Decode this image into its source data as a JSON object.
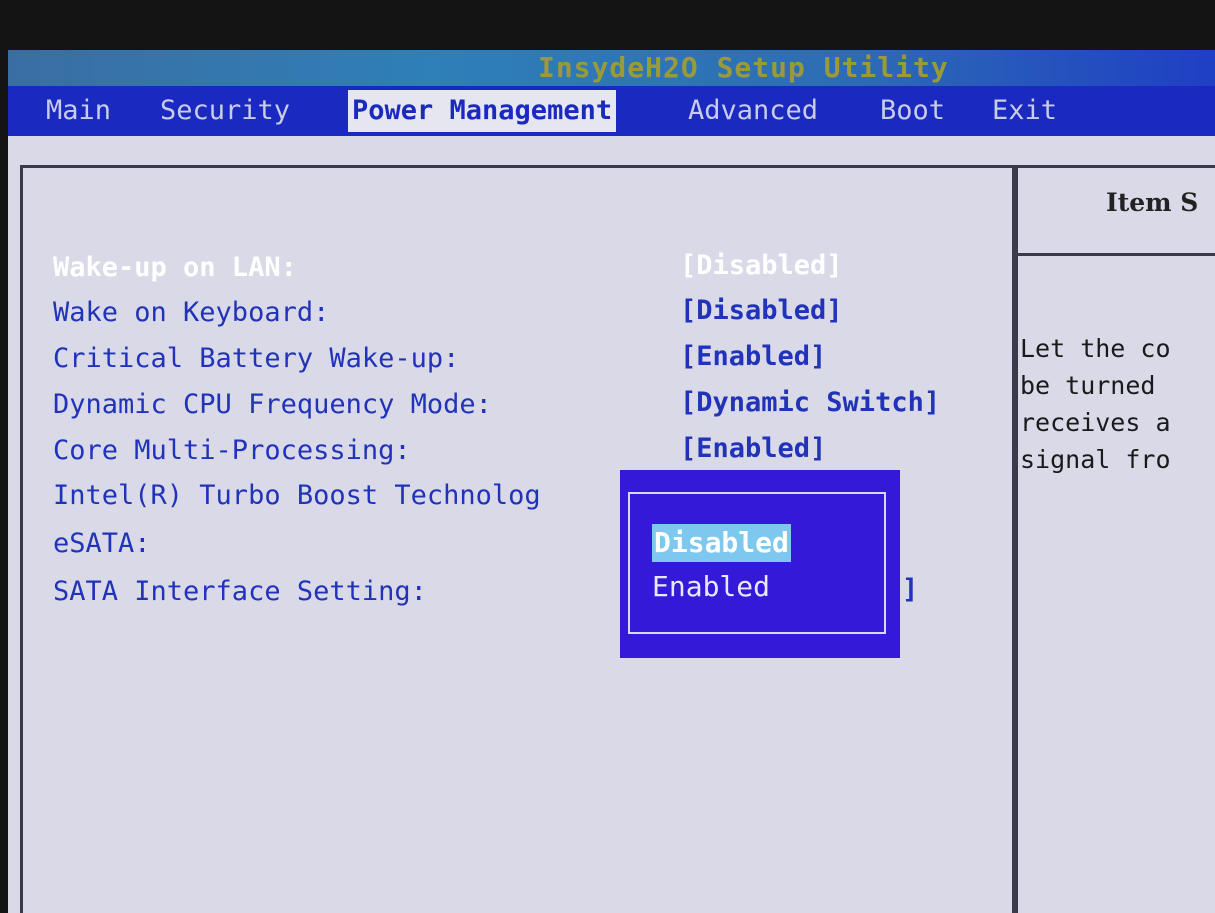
{
  "title": "InsydeH2O Setup Utility",
  "menu": {
    "items": [
      {
        "label": "Main"
      },
      {
        "label": "Security"
      },
      {
        "label": "Power Management"
      },
      {
        "label": "Advanced"
      },
      {
        "label": "Boot"
      },
      {
        "label": "Exit"
      }
    ],
    "active": "Power Management"
  },
  "settings": [
    {
      "label": "Wake-up on LAN:",
      "value": "[Disabled]"
    },
    {
      "label": "Wake on Keyboard:",
      "value": "[Disabled]"
    },
    {
      "label": "Critical Battery Wake-up:",
      "value": "[Enabled]"
    },
    {
      "label": "Dynamic CPU Frequency Mode:",
      "value": "[Dynamic Switch]"
    },
    {
      "label": "Core Multi-Processing:",
      "value": "[Enabled]"
    },
    {
      "label": "Intel(R) Turbo Boost Technolog",
      "value": ""
    },
    {
      "label": "eSATA:",
      "value": ""
    },
    {
      "label": "SATA Interface Setting:",
      "value": "]"
    }
  ],
  "popup": {
    "options": [
      "Disabled",
      "Enabled"
    ],
    "highlighted": "Disabled"
  },
  "help": {
    "title": "Item S",
    "lines": [
      "Let the co",
      "be turned",
      "receives a",
      "signal fro"
    ]
  },
  "colors": {
    "menu_bg": "#1a2ac0",
    "popup_bg": "#3419d8",
    "popup_highlight": "#7ec8f0",
    "setting_text": "#2133b8",
    "screen_bg": "#d9d9e8"
  }
}
